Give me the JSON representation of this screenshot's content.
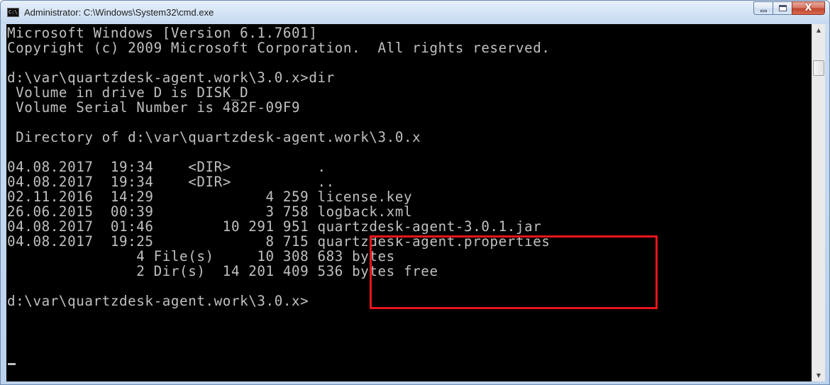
{
  "window": {
    "title": "Administrator: C:\\Windows\\System32\\cmd.exe",
    "icon": "cmd-console-icon",
    "icon_label": "C:\\"
  },
  "caption_buttons": {
    "minimize": "minimize-icon",
    "maximize": "maximize-icon",
    "close": "close-icon",
    "close_glyph": "X"
  },
  "colors": {
    "console_background": "#000000",
    "console_text": "#c0c0c0",
    "highlight_border": "#e8141c"
  },
  "console": {
    "lines": [
      "Microsoft Windows [Version 6.1.7601]",
      "Copyright (c) 2009 Microsoft Corporation.  All rights reserved.",
      "",
      "d:\\var\\quartzdesk-agent.work\\3.0.x>dir",
      " Volume in drive D is DISK_D",
      " Volume Serial Number is 482F-09F9",
      "",
      " Directory of d:\\var\\quartzdesk-agent.work\\3.0.x",
      "",
      "04.08.2017  19:34    <DIR>          .",
      "04.08.2017  19:34    <DIR>          ..",
      "02.11.2016  14:29             4 259 license.key",
      "26.06.2015  00:39             3 758 logback.xml",
      "04.08.2017  01:46        10 291 951 quartzdesk-agent-3.0.1.jar",
      "04.08.2017  19:25             8 715 quartzdesk-agent.properties",
      "               4 File(s)     10 308 683 bytes",
      "               2 Dir(s)  14 201 409 536 bytes free",
      "",
      "d:\\var\\quartzdesk-agent.work\\3.0.x>"
    ]
  },
  "scrollbar": {
    "up_glyph": "▲",
    "down_glyph": "▼"
  }
}
